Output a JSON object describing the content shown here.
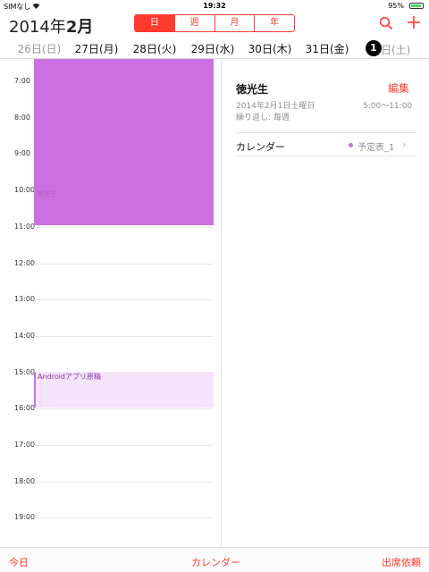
{
  "status_bar": {
    "carrier": "SIMなし",
    "time": "19:32",
    "battery": "95%",
    "battery_level": 0.95
  },
  "header": {
    "year_label": "2014年",
    "month_label": "2月",
    "segments": [
      "日",
      "週",
      "月",
      "年"
    ],
    "active_segment": "日"
  },
  "day_strip": {
    "days": [
      "26日(日)",
      "27日(月)",
      "28日(火)",
      "29日(水)",
      "30日(木)",
      "31日(金)"
    ],
    "selected_number": "1",
    "selected_rest": "日(土)"
  },
  "timeline": {
    "hours": [
      "7:00",
      "8:00",
      "9:00",
      "10:00",
      "11:00",
      "12:00",
      "13:00",
      "14:00",
      "15:00",
      "16:00",
      "17:00",
      "18:00",
      "19:00"
    ],
    "events": {
      "main_label": "徳光生",
      "android_label": "Androidアプリ原稿"
    },
    "colors": {
      "event_purple": "#cc6fe2",
      "event_light": "#f4e3fa",
      "accent_red": "#ff3b30"
    }
  },
  "detail": {
    "title": "徳光生",
    "edit_label": "編集",
    "date": "2014年2月1日土曜日",
    "time_range": "5:00〜11:00",
    "repeat": "繰り返し: 毎週",
    "calendar_label": "カレンダー",
    "calendar_value": "予定表_1"
  },
  "toolbar": {
    "today": "今日",
    "calendars": "カレンダー",
    "invitations": "出席依頼"
  }
}
